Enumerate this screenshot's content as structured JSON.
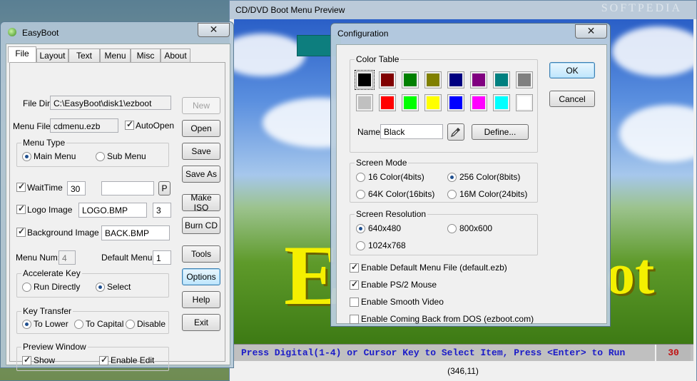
{
  "preview": {
    "title": "CD/DVD Boot Menu Preview",
    "watermark": "SOFTPEDIA",
    "big_text_left": "E",
    "big_text_right": "oot",
    "run_message": "Press Digital(1-4) or Cursor Key to Select Item, Press <Enter> to Run",
    "countdown": "30",
    "coordinates": "(346,11)"
  },
  "easyboot": {
    "title": "EasyBoot",
    "close_label": "✕",
    "tabs": [
      {
        "label": "File",
        "selected": true
      },
      {
        "label": "Layout"
      },
      {
        "label": "Text"
      },
      {
        "label": "Menu"
      },
      {
        "label": "Misc"
      },
      {
        "label": "About"
      }
    ],
    "file_dir_label": "File Dir:",
    "file_dir_value": "C:\\EasyBoot\\disk1\\ezboot",
    "menu_file_label": "Menu File:",
    "menu_file_value": "cdmenu.ezb",
    "autoopen_label": "AutoOpen",
    "menu_type": {
      "title": "Menu Type",
      "main_label": "Main Menu",
      "sub_label": "Sub Menu",
      "selected": "Main Menu"
    },
    "waittime_label": "WaitTime",
    "waittime_value": "30",
    "p_button": "P",
    "logo_label": "Logo Image",
    "logo_value": "LOGO.BMP",
    "logo_num": "3",
    "bg_label": "Background Image",
    "bg_value": "BACK.BMP",
    "menu_num_label": "Menu Num:",
    "menu_num_value": "4",
    "default_menu_label": "Default Menu:",
    "default_menu_value": "1",
    "accelerate": {
      "title": "Accelerate Key",
      "run_label": "Run Directly",
      "select_label": "Select",
      "selected": "Select"
    },
    "key_transfer": {
      "title": "Key Transfer",
      "lower_label": "To Lower",
      "capital_label": "To Capital",
      "disable_label": "Disable",
      "selected": "To Lower"
    },
    "preview_window": {
      "title": "Preview Window",
      "show_label": "Show",
      "edit_label": "Enable Edit"
    },
    "buttons": {
      "new": "New",
      "open": "Open",
      "save": "Save",
      "save_as": "Save As",
      "make_iso": "Make ISO",
      "burn_cd": "Burn CD",
      "tools": "Tools",
      "options": "Options",
      "help": "Help",
      "exit": "Exit"
    }
  },
  "config": {
    "title": "Configuration",
    "close_label": "✕",
    "color_table_title": "Color Table",
    "colors": [
      "#000000",
      "#800000",
      "#008000",
      "#808000",
      "#000080",
      "#800080",
      "#008080",
      "#808080",
      "#c0c0c0",
      "#ff0000",
      "#00ff00",
      "#ffff00",
      "#0000ff",
      "#ff00ff",
      "#00ffff",
      "#ffffff"
    ],
    "name_label": "Name:",
    "name_value": "Black",
    "define_button": "Define...",
    "screen_mode": {
      "title": "Screen Mode",
      "opt_16": "16 Color(4bits)",
      "opt_256": "256 Color(8bits)",
      "opt_64k": "64K Color(16bits)",
      "opt_16m": "16M Color(24bits)",
      "selected": "256 Color(8bits)"
    },
    "screen_resolution": {
      "title": "Screen Resolution",
      "opt_640": "640x480",
      "opt_800": "800x600",
      "opt_1024": "1024x768",
      "selected": "640x480"
    },
    "options": {
      "default_menu": "Enable Default Menu File (default.ezb)",
      "ps2_mouse": "Enable PS/2 Mouse",
      "smooth_video": "Enable Smooth Video",
      "coming_back": "Enable Coming Back from DOS (ezboot.com)"
    },
    "ok_button": "OK",
    "cancel_button": "Cancel"
  }
}
